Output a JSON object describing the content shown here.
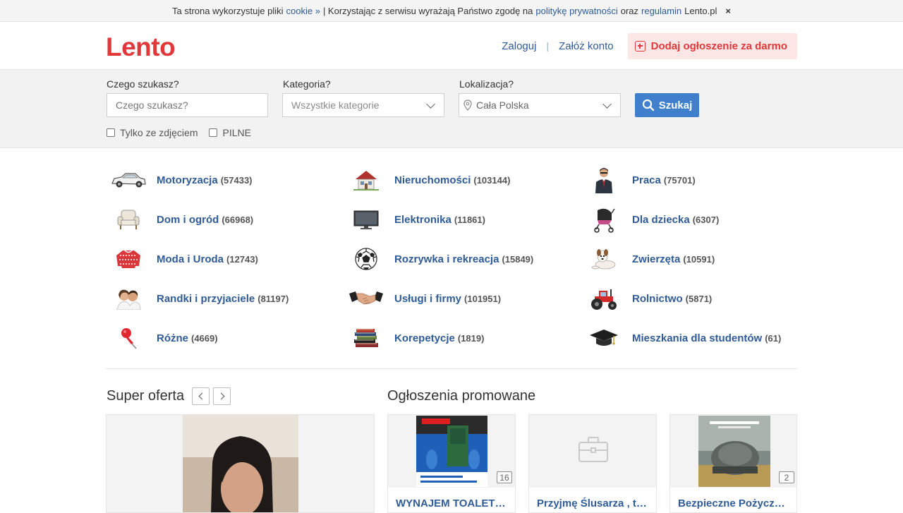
{
  "cookie": {
    "text1": "Ta strona wykorzystuje pliki",
    "link1": "cookie »",
    "text2": "| Korzystając z serwisu wyrażają Państwo zgodę na",
    "link2": "politykę prywatności",
    "text3": "oraz",
    "link3": "regulamin",
    "text4": "Lento.pl",
    "close": "×"
  },
  "header": {
    "logo": "Lento",
    "login": "Zaloguj",
    "separator": "|",
    "register": "Załóż konto",
    "add_listing": "Dodaj ogłoszenie za darmo"
  },
  "search": {
    "query_label": "Czego szukasz?",
    "query_placeholder": "Czego szukasz?",
    "category_label": "Kategoria?",
    "category_value": "Wszystkie kategorie",
    "location_label": "Lokalizacja?",
    "location_value": "Cała Polska",
    "button": "Szukaj",
    "only_photos": "Tylko ze zdjęciem",
    "urgent": "PILNE"
  },
  "categories": [
    {
      "name": "Motoryzacja",
      "count": "(57433)",
      "icon": "car-icon"
    },
    {
      "name": "Nieruchomości",
      "count": "(103144)",
      "icon": "house-icon"
    },
    {
      "name": "Praca",
      "count": "(75701)",
      "icon": "businessman-icon"
    },
    {
      "name": "Dom i ogród",
      "count": "(66968)",
      "icon": "armchair-icon"
    },
    {
      "name": "Elektronika",
      "count": "(11861)",
      "icon": "tv-icon"
    },
    {
      "name": "Dla dziecka",
      "count": "(6307)",
      "icon": "stroller-icon"
    },
    {
      "name": "Moda i Uroda",
      "count": "(12743)",
      "icon": "sweater-icon"
    },
    {
      "name": "Rozrywka i rekreacja",
      "count": "(15849)",
      "icon": "football-icon"
    },
    {
      "name": "Zwierzęta",
      "count": "(10591)",
      "icon": "dog-icon"
    },
    {
      "name": "Randki i przyjaciele",
      "count": "(81197)",
      "icon": "couple-icon"
    },
    {
      "name": "Usługi i firmy",
      "count": "(101951)",
      "icon": "handshake-icon"
    },
    {
      "name": "Rolnictwo",
      "count": "(5871)",
      "icon": "tractor-icon"
    },
    {
      "name": "Różne",
      "count": "(4669)",
      "icon": "pushpin-icon"
    },
    {
      "name": "Korepetycje",
      "count": "(1819)",
      "icon": "books-icon"
    },
    {
      "name": "Mieszkania dla studentów",
      "count": "(61)",
      "icon": "graduation-cap-icon"
    }
  ],
  "super_offer": {
    "title": "Super oferta",
    "prev": "previous-arrow-icon",
    "next": "next-arrow-icon"
  },
  "promoted": {
    "title": "Ogłoszenia promowane",
    "items": [
      {
        "title": "WYNAJEM TOALET or...",
        "photos": "16"
      },
      {
        "title": "Przyjmę Ślusarza , to...",
        "photos": ""
      },
      {
        "title": "Bezpieczne Pożyczki ...",
        "photos": "2"
      }
    ]
  },
  "colors": {
    "brand": "#e0383b",
    "link": "#2f5b96",
    "search_button": "#3f7fcc"
  }
}
